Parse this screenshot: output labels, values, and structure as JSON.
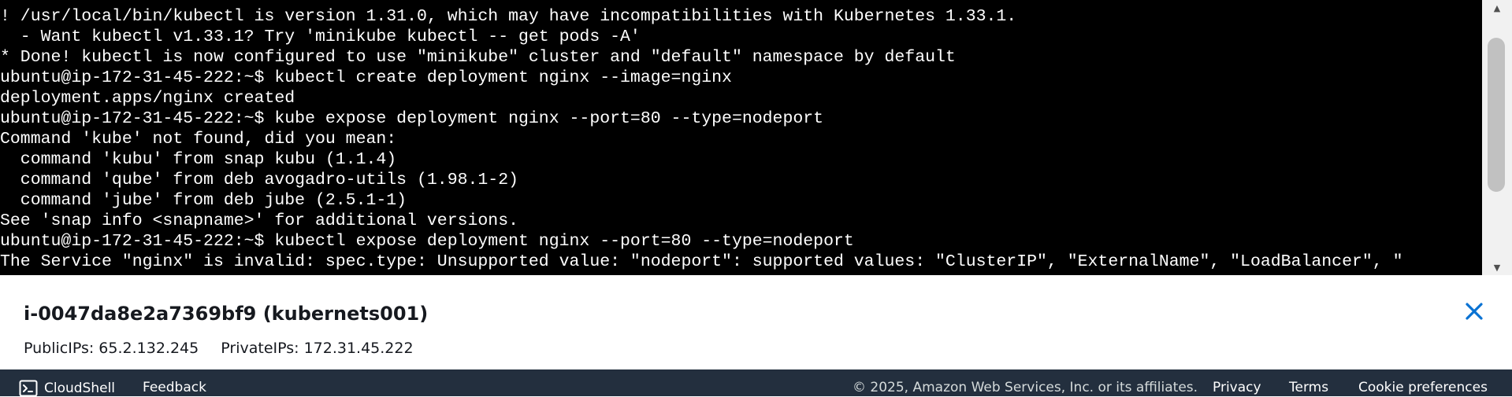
{
  "terminal": {
    "lines": [
      "! /usr/local/bin/kubectl is version 1.31.0, which may have incompatibilities with Kubernetes 1.33.1.",
      "  - Want kubectl v1.33.1? Try 'minikube kubectl -- get pods -A'",
      "* Done! kubectl is now configured to use \"minikube\" cluster and \"default\" namespace by default",
      "ubuntu@ip-172-31-45-222:~$ kubectl create deployment nginx --image=nginx",
      "deployment.apps/nginx created",
      "ubuntu@ip-172-31-45-222:~$ kube expose deployment nginx --port=80 --type=nodeport",
      "Command 'kube' not found, did you mean:",
      "  command 'kubu' from snap kubu (1.1.4)",
      "  command 'qube' from deb avogadro-utils (1.98.1-2)",
      "  command 'jube' from deb jube (2.5.1-1)",
      "See 'snap info <snapname>' for additional versions.",
      "ubuntu@ip-172-31-45-222:~$ kubectl expose deployment nginx --port=80 --type=nodeport",
      "The Service \"nginx\" is invalid: spec.type: Unsupported value: \"nodeport\": supported values: \"ClusterIP\", \"ExternalName\", \"LoadBalancer\", \""
    ],
    "text_color": "#ffffff",
    "background": "#000000"
  },
  "scrollbar": {
    "up_arrow": "▲",
    "down_arrow": "▼"
  },
  "instance": {
    "title": "i-0047da8e2a7369bf9 (kubernets001)",
    "public_ips": "PublicIPs: 65.2.132.245",
    "private_ips": "PrivateIPs: 172.31.45.222"
  },
  "footer": {
    "cloudshell_label": "CloudShell",
    "feedback_label": "Feedback",
    "copyright": "© 2025, Amazon Web Services, Inc. or its affiliates.",
    "privacy_label": "Privacy",
    "terms_label": "Terms",
    "cookie_label": "Cookie preferences",
    "background": "#232f3e"
  },
  "icons": {
    "close": "close-icon",
    "cloudshell": "terminal-prompt-icon"
  },
  "colors": {
    "close_icon": "#0972d3"
  }
}
